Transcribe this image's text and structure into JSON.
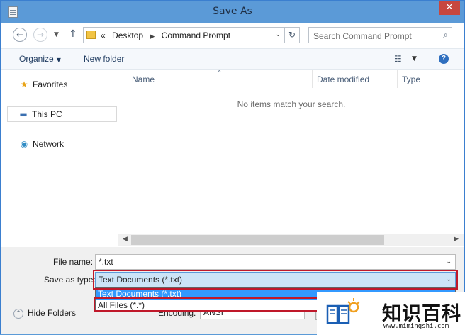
{
  "window": {
    "title": "Save As",
    "close_glyph": "✕"
  },
  "nav": {
    "back_glyph": "←",
    "forward_glyph": "→",
    "recent_glyph": "▼",
    "up_glyph": "↑",
    "address": {
      "overflow": "«",
      "crumbs": [
        "Desktop",
        "Command Prompt"
      ],
      "sep_glyph": "▶",
      "dropdown_glyph": "⌄",
      "refresh_glyph": "↻"
    },
    "search": {
      "placeholder": "Search Command Prompt",
      "icon": "search-icon",
      "glyph": "⌕"
    }
  },
  "toolbar": {
    "organize_label": "Organize",
    "new_folder_label": "New folder",
    "caret": "▼",
    "view_glyph": "☷",
    "help_glyph": "?"
  },
  "sidebar": {
    "items": [
      {
        "label": "Favorites",
        "icon": "star-icon",
        "glyph": "★"
      },
      {
        "label": "This PC",
        "icon": "computer-icon",
        "glyph": "▬"
      },
      {
        "label": "Network",
        "icon": "network-icon",
        "glyph": "◉"
      }
    ]
  },
  "file_list": {
    "columns": [
      "Name",
      "Date modified",
      "Type"
    ],
    "sort_glyph": "^",
    "empty_message": "No items match your search."
  },
  "scrollbar": {
    "left_glyph": "◀",
    "right_glyph": "▶"
  },
  "form": {
    "file_name_label": "File name:",
    "file_name_value": "*.txt",
    "save_type_label": "Save as type:",
    "save_type_value": "Text Documents (*.txt)",
    "save_type_options": [
      "Text Documents (*.txt)",
      "All Files  (*.*)"
    ],
    "dropdown_glyph": "⌄",
    "encoding_label": "Encoding:",
    "encoding_value": "ANSI",
    "hide_folders_label": "Hide Folders",
    "hide_folders_glyph": "^"
  },
  "colors": {
    "titlebar": "#5b9ad7",
    "highlight": "#c0182a",
    "selected_option": "#3399ff"
  },
  "watermark": {
    "text": "知识百科",
    "url": "www.mimingshi.com"
  }
}
